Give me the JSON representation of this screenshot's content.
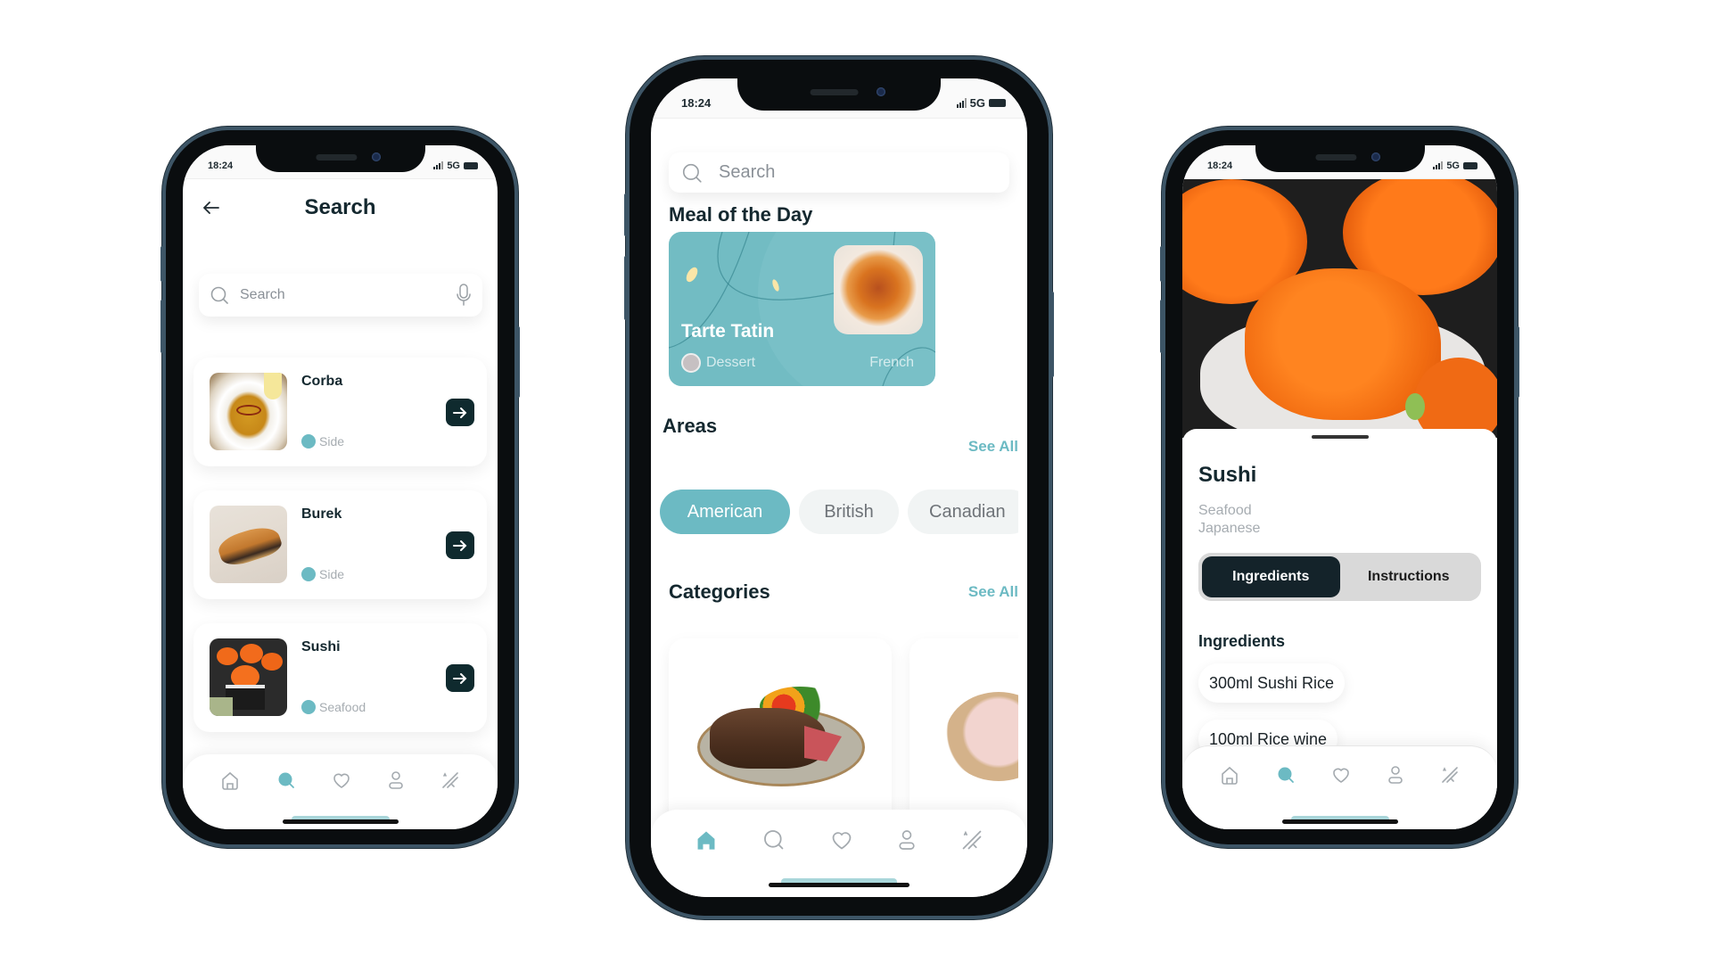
{
  "status_bar": {
    "time": "18:24",
    "network": "5G"
  },
  "accent_color": "#6cbac3",
  "dark_color": "#0f2a2e",
  "nav_items": [
    {
      "icon": "home-icon"
    },
    {
      "icon": "search-icon"
    },
    {
      "icon": "heart-icon"
    },
    {
      "icon": "profile-icon"
    },
    {
      "icon": "magic-wand-icon"
    }
  ],
  "search_screen": {
    "title": "Search",
    "back_icon": "arrow-left-icon",
    "search": {
      "placeholder": "Search",
      "mic_icon": "microphone-icon"
    },
    "active_nav": "search",
    "results": [
      {
        "name": "Corba",
        "category": "Side"
      },
      {
        "name": "Burek",
        "category": "Side"
      },
      {
        "name": "Sushi",
        "category": "Seafood"
      }
    ]
  },
  "home_screen": {
    "search": {
      "placeholder": "Search"
    },
    "meal_of_day": {
      "heading": "Meal of the Day",
      "name": "Tarte Tatin",
      "category": "Dessert",
      "area": "French"
    },
    "areas": {
      "heading": "Areas",
      "see_all": "See All",
      "chips": [
        {
          "label": "American",
          "active": true
        },
        {
          "label": "British",
          "active": false
        },
        {
          "label": "Canadian",
          "active": false
        }
      ]
    },
    "categories": {
      "heading": "Categories",
      "see_all": "See All",
      "items": [
        {
          "image": "beef-steak-plate"
        },
        {
          "image": "raw-chicken-plate"
        }
      ]
    },
    "active_nav": "home"
  },
  "detail_screen": {
    "name": "Sushi",
    "category": "Seafood",
    "area": "Japanese",
    "tabs": [
      {
        "label": "Ingredients",
        "active": true
      },
      {
        "label": "Instructions",
        "active": false
      }
    ],
    "ingredients_heading": "Ingredients",
    "ingredients": [
      "300ml Sushi Rice",
      "100ml Rice wine"
    ],
    "active_nav": "search"
  }
}
